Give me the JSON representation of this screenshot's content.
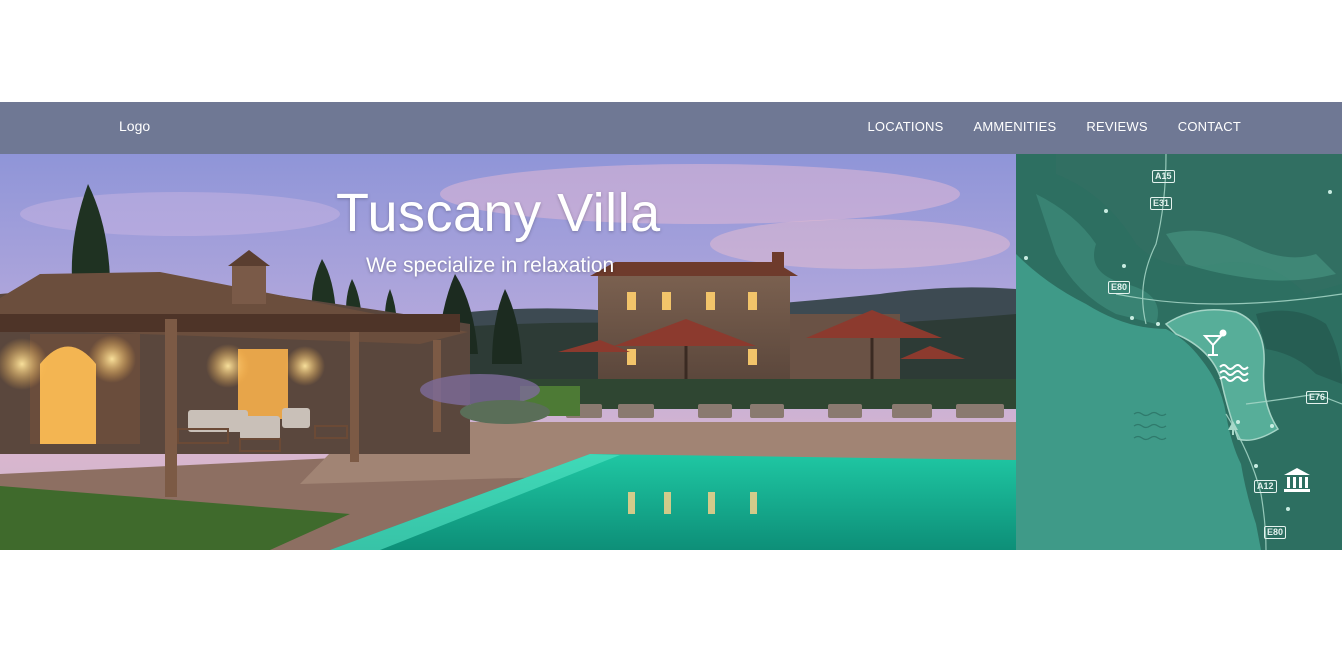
{
  "navbar": {
    "logo": "Logo",
    "links": [
      {
        "label": "LOCATIONS"
      },
      {
        "label": "AMMENITIES"
      },
      {
        "label": "REVIEWS"
      },
      {
        "label": "CONTACT"
      }
    ],
    "background": "#6f7894"
  },
  "hero": {
    "title": "Tuscany Villa",
    "subtitle": "We specialize in relaxation"
  },
  "map": {
    "road_labels": [
      "A15",
      "E31",
      "E80",
      "E76",
      "A12",
      "E80"
    ],
    "icons": [
      "cocktail-icon",
      "waves-icon",
      "museum-icon",
      "tree-icon"
    ],
    "colors": {
      "land": "#2b6b5e",
      "sea": "#3f9a88",
      "highlight": "#5fb9a3"
    }
  }
}
